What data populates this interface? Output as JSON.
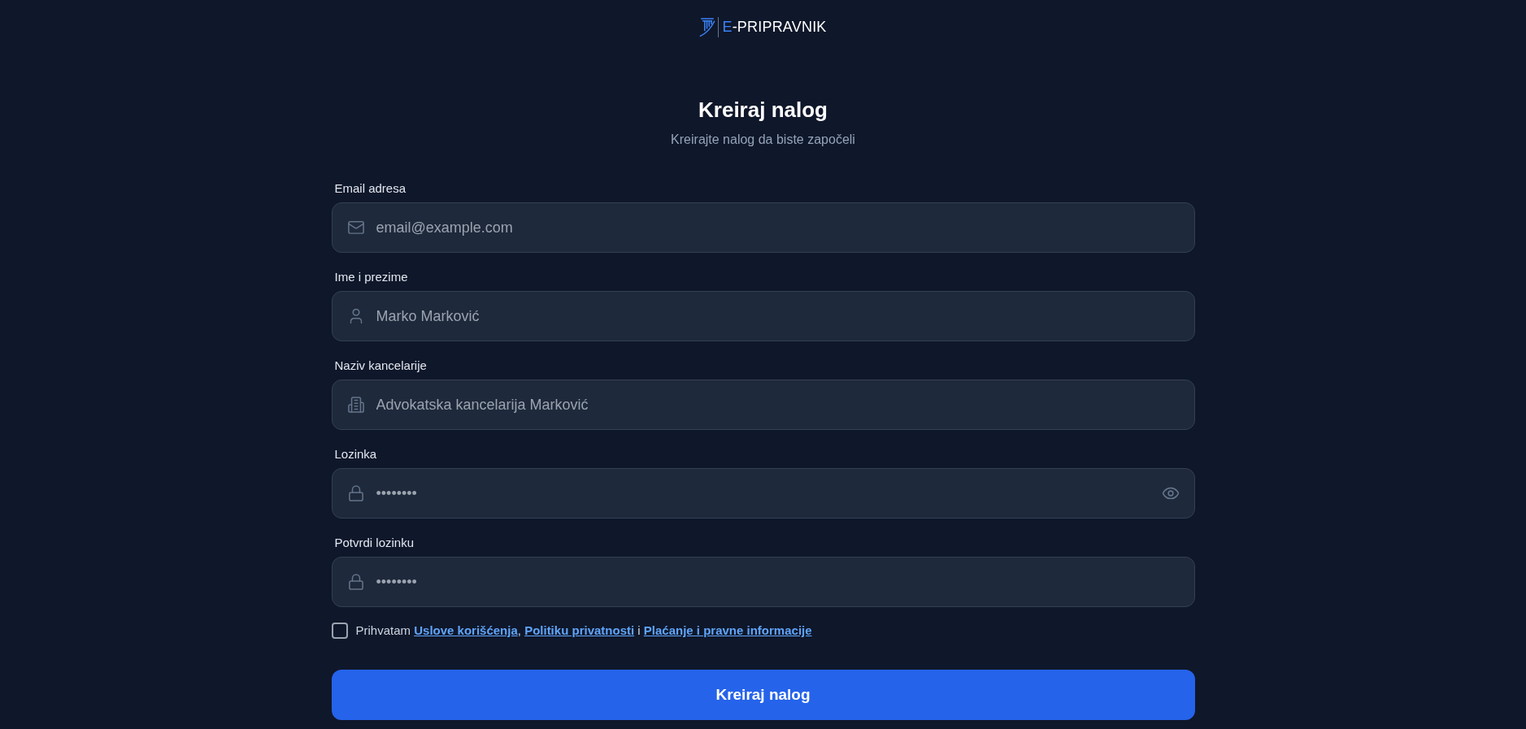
{
  "header": {
    "logo": {
      "accent": "E",
      "text": "-PRIPRAVNIK"
    }
  },
  "heading": {
    "title": "Kreiraj nalog",
    "subtitle": "Kreirajte nalog da biste započeli"
  },
  "fields": [
    {
      "label": "Email adresa",
      "kind": "email",
      "placeholder": "email@example.com",
      "reveal_toggle": false
    },
    {
      "label": "Ime i prezime",
      "kind": "name",
      "placeholder": "Marko Marković",
      "reveal_toggle": false
    },
    {
      "label": "Naziv kancelarije",
      "kind": "office",
      "placeholder": "Advokatska kancelarija Marković",
      "reveal_toggle": false
    },
    {
      "label": "Lozinka",
      "kind": "password",
      "placeholder": "••••••••",
      "reveal_toggle": true
    },
    {
      "label": "Potvrdi lozinku",
      "kind": "password",
      "placeholder": "••••••••",
      "reveal_toggle": false
    }
  ],
  "terms": {
    "checked": false,
    "parts": [
      {
        "kind": "text",
        "text": "Prihvatam "
      },
      {
        "kind": "link",
        "text": "Uslove korišćenja"
      },
      {
        "kind": "text",
        "text": ", "
      },
      {
        "kind": "link",
        "text": "Politiku privatnosti"
      },
      {
        "kind": "text",
        "text": " i "
      },
      {
        "kind": "link",
        "text": "Plaćanje i pravne informacije"
      }
    ]
  },
  "submit_button": "Kreiraj nalog"
}
